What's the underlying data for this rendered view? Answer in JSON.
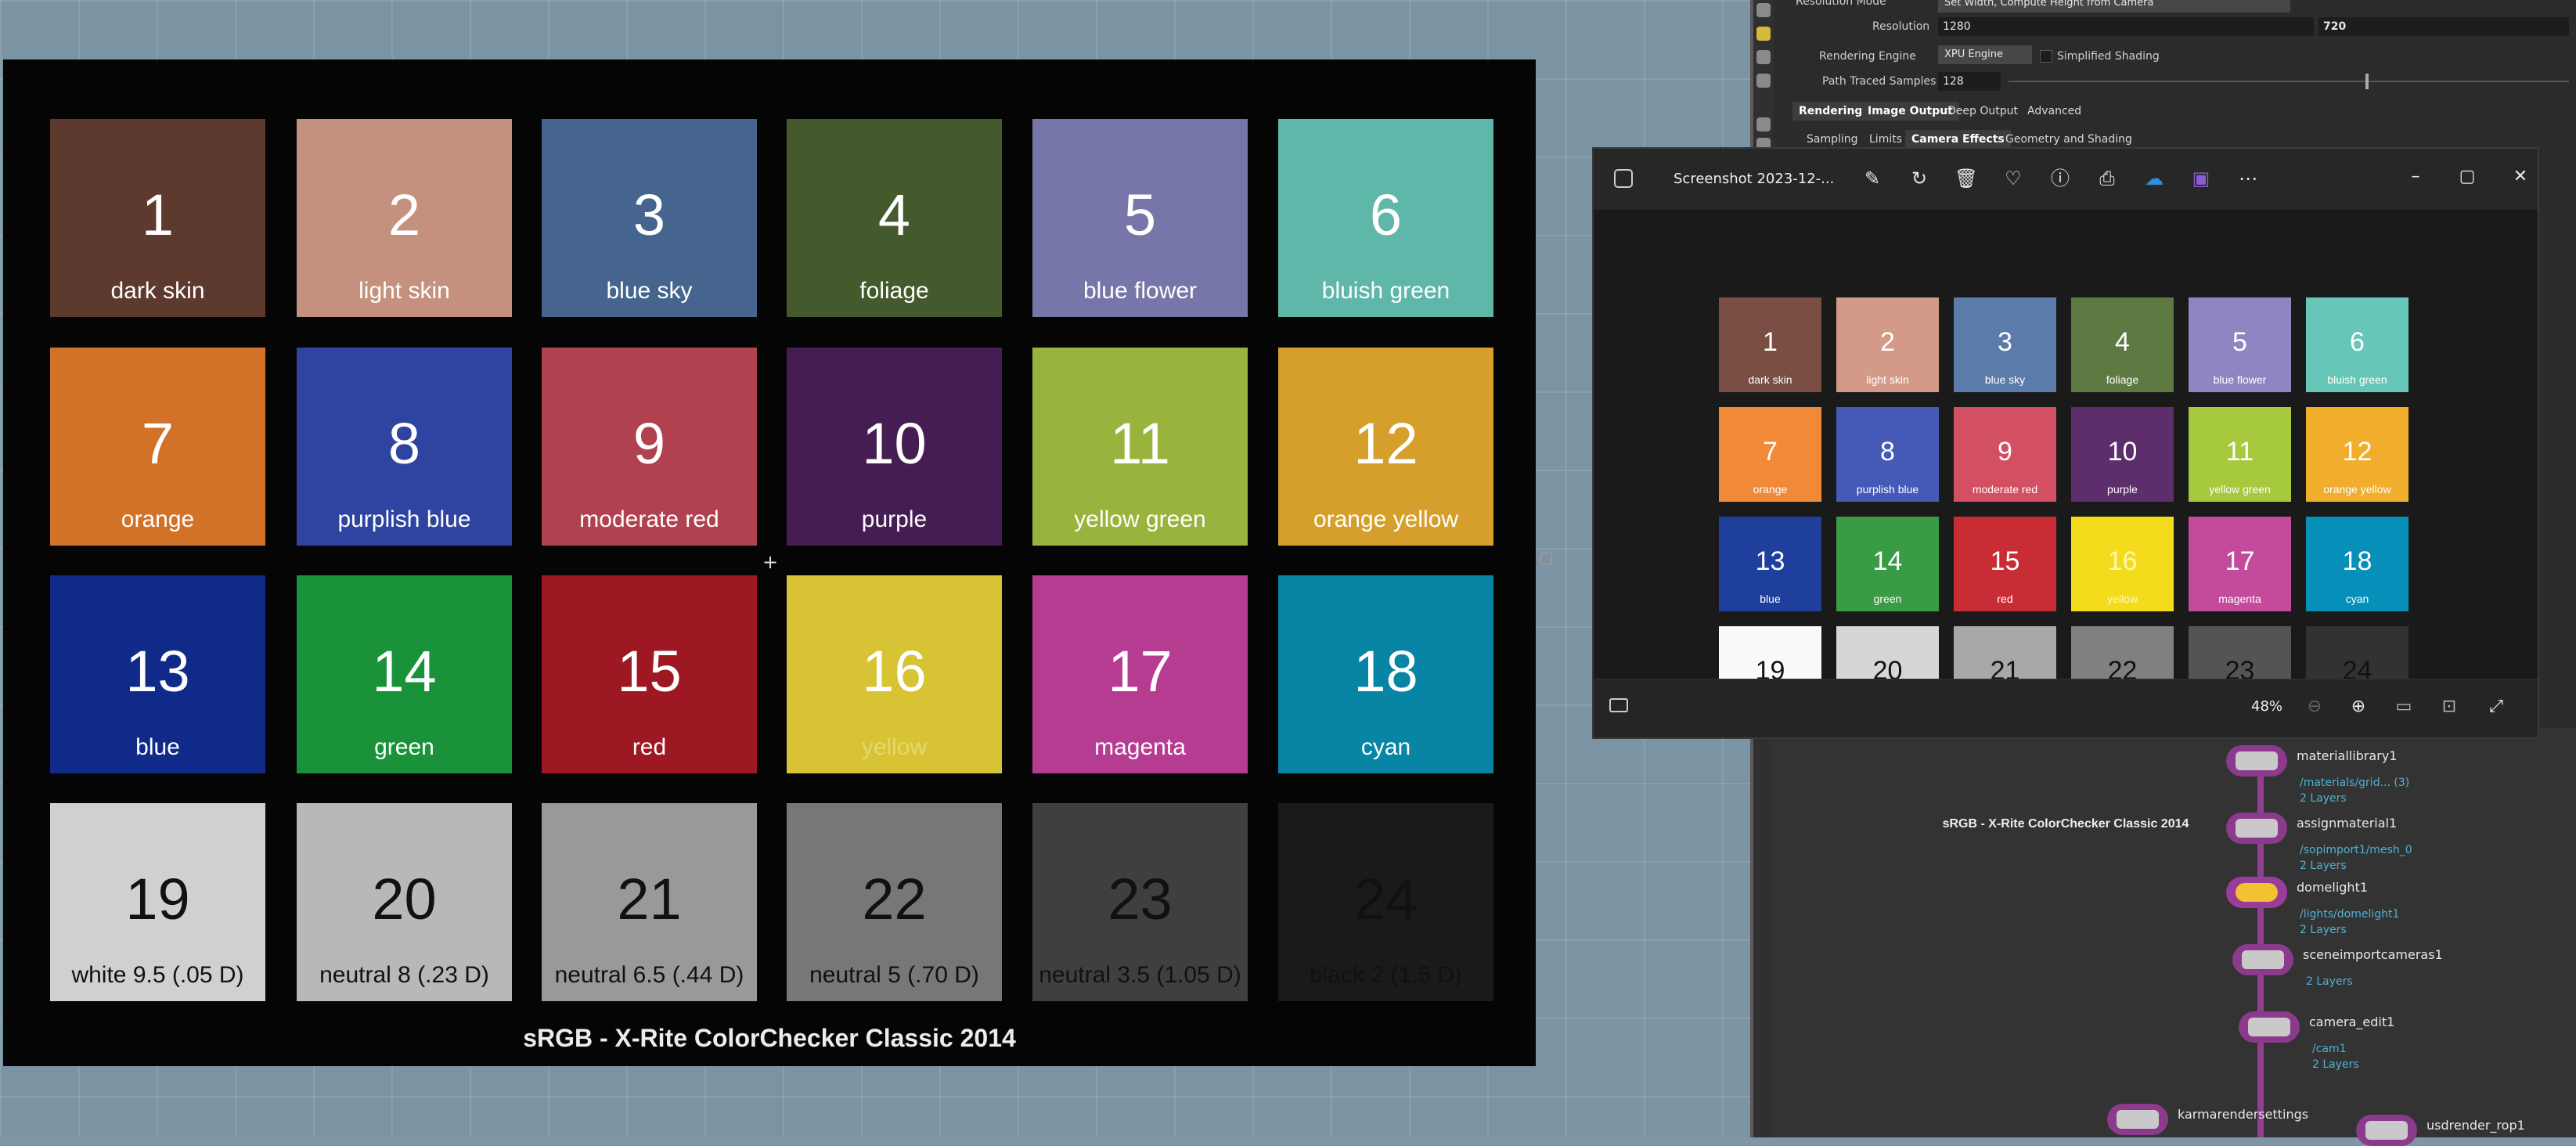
{
  "chart": {
    "title": "sRGB - X-Rite ColorChecker Classic 2014",
    "patches": [
      {
        "num": "1",
        "label": "dark skin",
        "color": "#5e3a2e"
      },
      {
        "num": "2",
        "label": "light skin",
        "color": "#c4917f"
      },
      {
        "num": "3",
        "label": "blue sky",
        "color": "#45658f"
      },
      {
        "num": "4",
        "label": "foliage",
        "color": "#445a2c"
      },
      {
        "num": "5",
        "label": "blue flower",
        "color": "#7776a8"
      },
      {
        "num": "6",
        "label": "bluish green",
        "color": "#5fb7aa"
      },
      {
        "num": "7",
        "label": "orange",
        "color": "#d27229"
      },
      {
        "num": "8",
        "label": "purplish blue",
        "color": "#2f44a0"
      },
      {
        "num": "9",
        "label": "moderate red",
        "color": "#b0424f"
      },
      {
        "num": "10",
        "label": "purple",
        "color": "#451d52"
      },
      {
        "num": "11",
        "label": "yellow green",
        "color": "#99b43c"
      },
      {
        "num": "12",
        "label": "orange yellow",
        "color": "#d69f2b"
      },
      {
        "num": "13",
        "label": "blue",
        "color": "#102a8a"
      },
      {
        "num": "14",
        "label": "green",
        "color": "#1a9239"
      },
      {
        "num": "15",
        "label": "red",
        "color": "#9d1822"
      },
      {
        "num": "16",
        "label": "yellow",
        "color": "#d7c333"
      },
      {
        "num": "17",
        "label": "magenta",
        "color": "#b53c91"
      },
      {
        "num": "18",
        "label": "cyan",
        "color": "#0884a5"
      },
      {
        "num": "19",
        "label": "white 9.5 (.05 D)",
        "color": "#d0d0d0"
      },
      {
        "num": "20",
        "label": "neutral 8 (.23 D)",
        "color": "#b8b8b8"
      },
      {
        "num": "21",
        "label": "neutral 6.5 (.44 D)",
        "color": "#999999"
      },
      {
        "num": "22",
        "label": "neutral 5 (.70 D)",
        "color": "#777777"
      },
      {
        "num": "23",
        "label": "neutral 3.5 (1.05 D)",
        "color": "#3f3f3f"
      },
      {
        "num": "24",
        "label": "black 2 (1.5 D)",
        "color": "#1a1a1a"
      }
    ],
    "small_colors": [
      "#7a4e42",
      "#d39a87",
      "#5b7cab",
      "#5e7a42",
      "#8e86c2",
      "#66c6b7",
      "#f08a36",
      "#4559b7",
      "#d35062",
      "#5d2d6c",
      "#a6c93d",
      "#f1ae2c",
      "#1e3f9c",
      "#3a9b45",
      "#c82d35",
      "#f4dc1c",
      "#c44a9c",
      "#0690b9",
      "#fafafa",
      "#d6d6d6",
      "#a8a8a8",
      "#808080",
      "#545454",
      "#323232"
    ]
  },
  "photos": {
    "title": "Screenshot 2023-12-...",
    "zoom": "48%",
    "toolbar_icons": [
      "edit-icon",
      "rotate-icon",
      "delete-icon",
      "favorite-icon",
      "info-icon",
      "print-icon",
      "onedrive-icon",
      "clipchamp-icon",
      "more-icon"
    ]
  },
  "panel": {
    "resolution_mode_label": "Resolution Mode",
    "resolution_mode_value": "Set Width, Compute Height from Camera",
    "resolution_label": "Resolution",
    "resolution_w": "1280",
    "resolution_h": "720",
    "engine_label": "Rendering Engine",
    "engine_value": "XPU Engine",
    "simplified_shading": "Simplified Shading",
    "samples_label": "Path Traced Samples",
    "samples_value": "128",
    "tabs1": [
      "Rendering",
      "Image Output",
      "Deep Output",
      "Advanced"
    ],
    "tabs2": [
      "Sampling",
      "Limits",
      "Camera Effects",
      "Geometry and Shading"
    ]
  },
  "nodes": [
    {
      "name": "materiallibrary1",
      "sub1": "/materials/grid... (3)",
      "sub2": "2 Layers"
    },
    {
      "name": "assignmaterial1",
      "sub1": "/sopimport1/mesh_0",
      "sub2": "2 Layers"
    },
    {
      "name": "domelight1",
      "sub1": "/lights/domelight1",
      "sub2": "2 Layers"
    },
    {
      "name": "sceneimportcameras1",
      "sub1": "",
      "sub2": "2 Layers"
    },
    {
      "name": "camera_edit1",
      "sub1": "/cam1",
      "sub2": "2 Layers"
    },
    {
      "name": "karmarendersettings",
      "sub1": "",
      "sub2": ""
    },
    {
      "name": "usdrender_rop1",
      "sub1": "",
      "sub2": ""
    }
  ]
}
